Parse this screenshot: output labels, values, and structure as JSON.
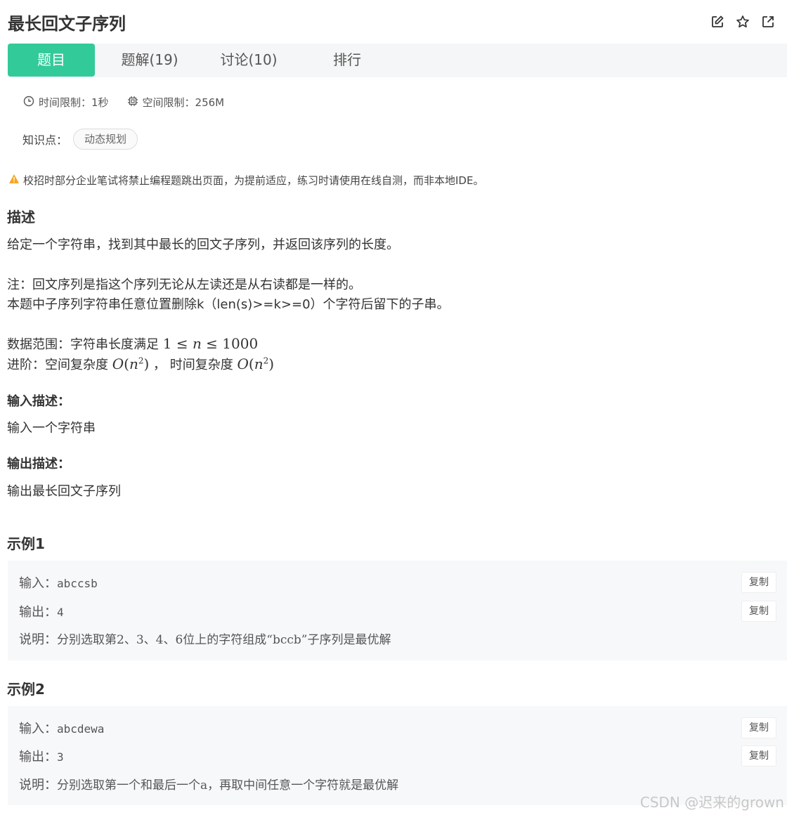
{
  "title": "最长回文子序列",
  "icons": [
    "edit-icon",
    "star-icon",
    "external-link-icon"
  ],
  "tabs": [
    {
      "label": "题目"
    },
    {
      "label": "题解(19)"
    },
    {
      "label": "讨论(10)"
    },
    {
      "label": "排行"
    }
  ],
  "meta": {
    "time_limit": "时间限制：1秒",
    "space_limit": "空间限制：256M"
  },
  "knowledge": {
    "label": "知识点：",
    "tag": "动态规划"
  },
  "warning": "校招时部分企业笔试将禁止编程题跳出页面，为提前适应，练习时请使用在线自测，而非本地IDE。",
  "description": {
    "heading": "描述",
    "line1": "给定一个字符串，找到其中最长的回文子序列，并返回该序列的长度。",
    "line2": "注：回文序列是指这个序列无论从左读还是从右读都是一样的。",
    "line3": "本题中子序列字符串任意位置删除k（len(s)>=k>=0）个字符后留下的子串。",
    "range_label": "数据范围：字符串长度满足",
    "range_math": "1 ≤ n ≤ 1000",
    "advance_label": "进阶：空间复杂度",
    "advance_sep": "，  时间复杂度",
    "complexity": "O(n²)"
  },
  "input_desc": {
    "heading": "输入描述：",
    "text": "输入一个字符串"
  },
  "output_desc": {
    "heading": "输出描述：",
    "text": "输出最长回文子序列"
  },
  "examples": [
    {
      "heading": "示例1",
      "input_label": "输入：",
      "input": "abccsb",
      "output_label": "输出：",
      "output": "4",
      "note_label": "说明：",
      "note": "分别选取第2、3、4、6位上的字符组成“bccb”子序列是最优解"
    },
    {
      "heading": "示例2",
      "input_label": "输入：",
      "input": "abcdewa",
      "output_label": "输出：",
      "output": "3",
      "note_label": "说明：",
      "note": "分别选取第一个和最后一个a，再取中间任意一个字符就是最优解"
    }
  ],
  "copy_label": "复制",
  "watermark": "CSDN @迟来的grown",
  "colors": {
    "accent": "#32ca99",
    "warning": "#f5a623"
  }
}
